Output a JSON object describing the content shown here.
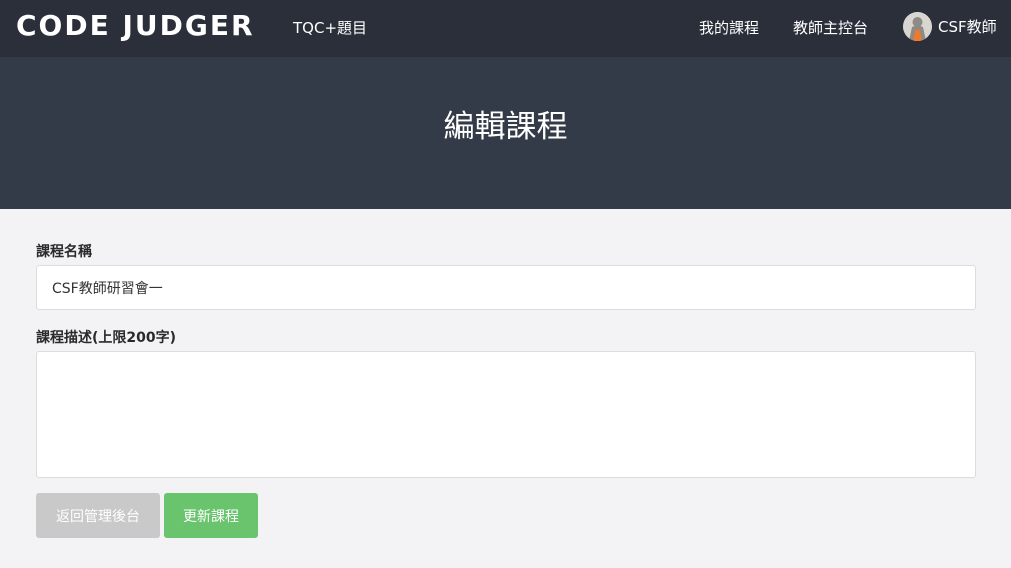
{
  "navbar": {
    "brand": "CODE JUDGER",
    "left_link": "TQC+題目",
    "my_courses": "我的課程",
    "teacher_dashboard": "教師主控台",
    "user_name": "CSF教師",
    "avatar_icon": "user-avatar-icon"
  },
  "hero": {
    "title": "編輯課程"
  },
  "form": {
    "course_name_label": "課程名稱",
    "course_name_value": "CSF教師研習會一",
    "course_desc_label": "課程描述(上限200字)",
    "course_desc_value": ""
  },
  "buttons": {
    "back_label": "返回管理後台",
    "update_label": "更新課程"
  },
  "colors": {
    "navbar_bg": "#2a2f3a",
    "hero_bg": "#343b48",
    "page_bg": "#f3f3f6",
    "back_button": "#c9c9c9",
    "update_button": "#6ac46e"
  }
}
